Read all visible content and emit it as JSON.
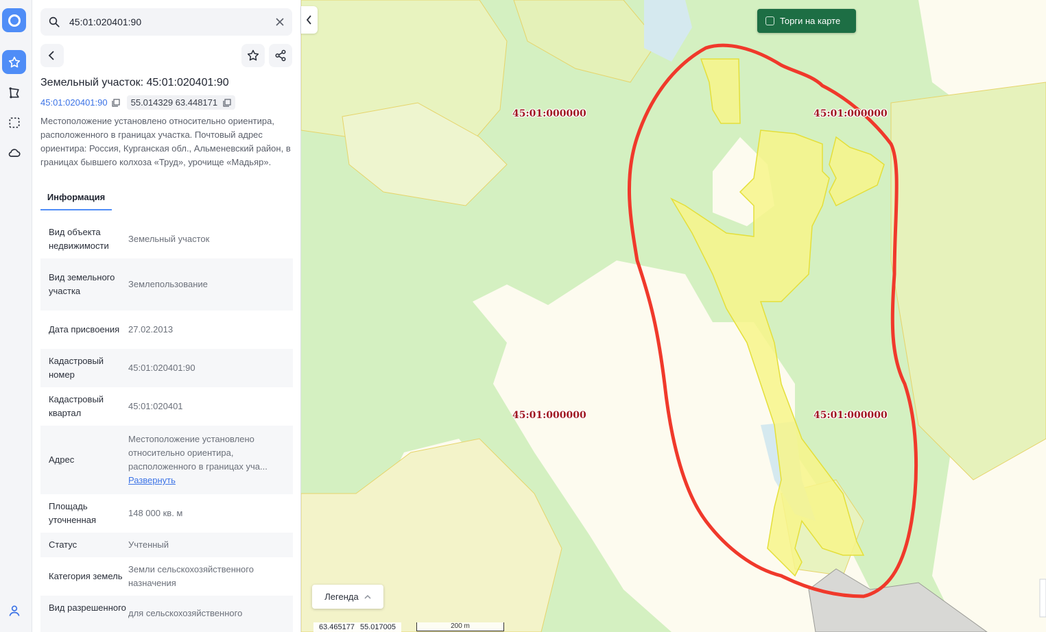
{
  "rail": {
    "items": [
      {
        "icon": "app-logo-icon"
      },
      {
        "icon": "star-icon",
        "active": true
      },
      {
        "icon": "polygon-tool-icon"
      },
      {
        "icon": "select-area-icon"
      },
      {
        "icon": "cloud-icon"
      },
      {
        "icon": "user-icon"
      }
    ]
  },
  "search": {
    "value": "45:01:020401:90"
  },
  "card": {
    "title": "Земельный участок: 45:01:020401:90",
    "cad_link": "45:01:020401:90",
    "coords": "55.014329 63.448171",
    "description": "Местоположение установлено относительно ориентира, расположенного в границах участка. Почтовый адрес ориентира: Россия, Курганская обл., Альменевский район, в границах бывшего колхоза «Труд», урочище «Мадьяр».",
    "tab": "Информация",
    "rows": [
      {
        "k": "Вид объекта недвижимости",
        "v": "Земельный участок"
      },
      {
        "k": "Вид земельного участка",
        "v": "Землепользование"
      },
      {
        "k": "Дата присвоения",
        "v": "27.02.2013"
      },
      {
        "k": "Кадастровый номер",
        "v": "45:01:020401:90"
      },
      {
        "k": "Кадастровый квартал",
        "v": "45:01:020401"
      },
      {
        "k": "Адрес",
        "v": "Местоположение установлено относительно ориентира, расположенного в границах уча...",
        "more": "Развернуть"
      },
      {
        "k": "Площадь уточненная",
        "v": "148 000 кв. м"
      },
      {
        "k": "Статус",
        "v": "Учтенный"
      },
      {
        "k": "Категория земель",
        "v": "Земли сельскохозяйственного назначения"
      },
      {
        "k": "Вид разрешенного",
        "v": "для сельскохозяйственного"
      }
    ]
  },
  "map": {
    "torgi_label": "Торги на карте",
    "legend_label": "Легенда",
    "lon": "63.465177",
    "lat": "55.017005",
    "scale_label": "200 m",
    "parcel_labels": [
      "45:01:000000",
      "45:01:000000",
      "45:01:000000",
      "45:01:000000"
    ]
  },
  "colors": {
    "accent": "#4f8df7",
    "link": "#3c73e6",
    "green_button": "#1d6e44",
    "cadastral_label": "#a01822",
    "highlight_outline": "#f0392b"
  }
}
